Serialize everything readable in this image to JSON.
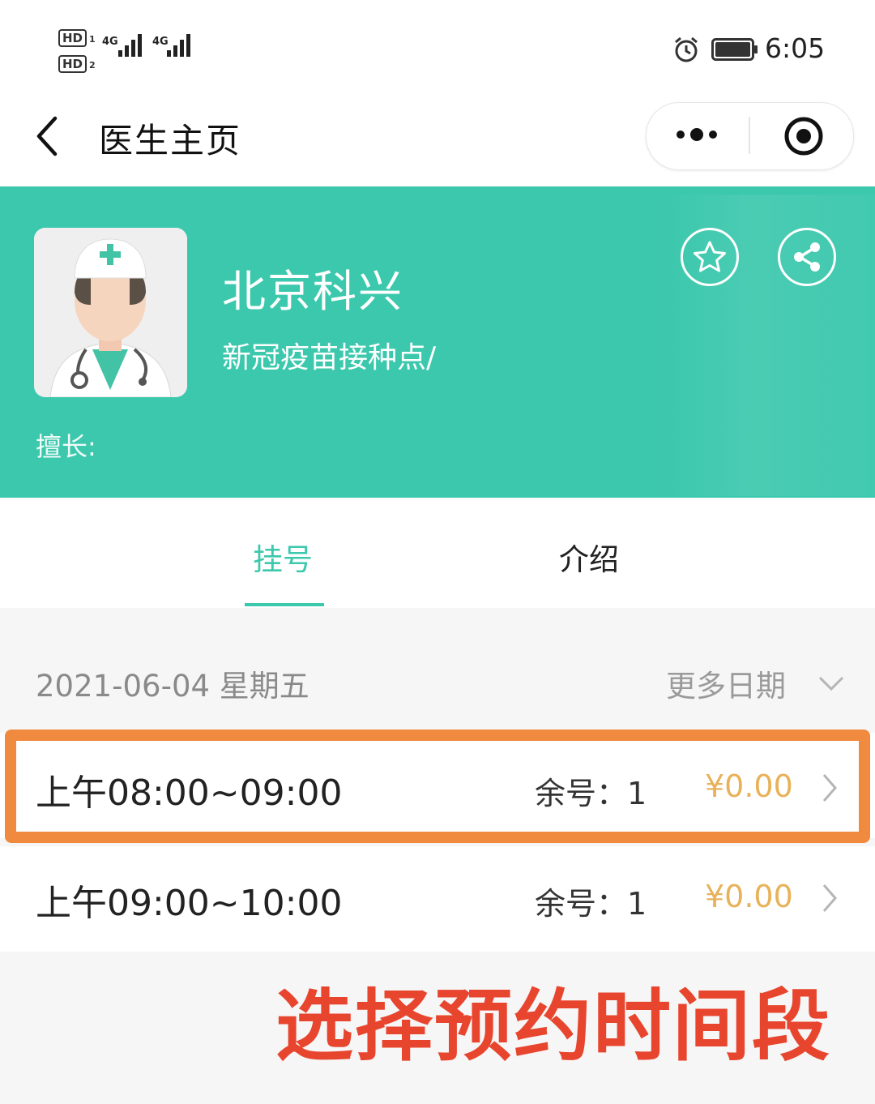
{
  "status_bar": {
    "sim1": "HD",
    "sim1_index": "1",
    "sim2": "HD",
    "sim2_index": "2",
    "network1": "4G",
    "network2": "4G",
    "time": "6:05",
    "alarm_icon": "alarm-clock-icon",
    "battery_icon": "battery-icon"
  },
  "nav": {
    "title": "医生主页",
    "back_icon": "chevron-left-icon",
    "more_icon": "more-dots-icon",
    "close_icon": "target-circle-icon"
  },
  "doctor": {
    "name": "北京科兴",
    "subtitle": "新冠疫苗接种点/",
    "speciality_label": "擅长:",
    "avatar_icon": "doctor-avatar-icon",
    "favorite_icon": "star-icon",
    "share_icon": "share-icon"
  },
  "tabs": [
    {
      "label": "挂号",
      "active": true
    },
    {
      "label": "介绍",
      "active": false
    }
  ],
  "schedule": {
    "date": "2021-06-04 星期五",
    "more_dates": "更多日期"
  },
  "slots": [
    {
      "time": "上午08:00~09:00",
      "remaining": "余号：1",
      "price": "¥0.00"
    },
    {
      "time": "上午09:00~10:00",
      "remaining": "余号：1",
      "price": "¥0.00"
    }
  ],
  "caption": "选择预约时间段",
  "colors": {
    "accent": "#3cc8ad",
    "price": "#e8b25a",
    "highlight": "#f08a3f",
    "caption": "#e8452e"
  }
}
